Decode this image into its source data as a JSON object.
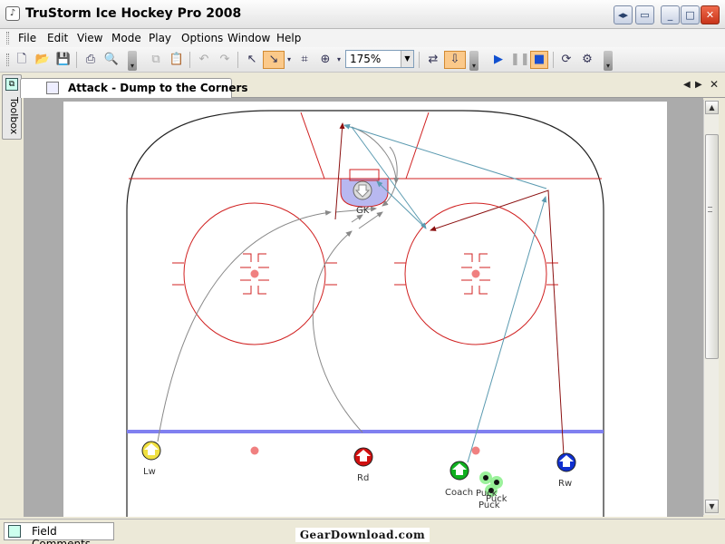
{
  "window": {
    "title": "TruStorm Ice Hockey Pro 2008",
    "icon": "app-icon",
    "controls": [
      "restore-icon",
      "dock-icon",
      "minimize-icon",
      "maximize-icon",
      "close-icon"
    ]
  },
  "menu": {
    "items": [
      {
        "label": "File"
      },
      {
        "label": "Edit"
      },
      {
        "label": "View"
      },
      {
        "label": "Mode"
      },
      {
        "label": "Play"
      },
      {
        "label": "Options"
      },
      {
        "label": "Window"
      },
      {
        "label": "Help"
      }
    ]
  },
  "toolbar": {
    "zoom": "175%",
    "buttons": [
      "new-file-icon",
      "open-folder-icon",
      "save-icon",
      "print-icon",
      "print-preview-icon",
      "copy-icon",
      "paste-icon",
      "undo-icon",
      "redo-icon",
      "select-arrow-icon",
      "draw-line-icon",
      "crop-icon",
      "zoom-icon",
      "animate-icon",
      "export-icon",
      "play-icon",
      "pause-icon",
      "stop-icon",
      "loop-icon",
      "settings-icon"
    ]
  },
  "sidebar": {
    "toolbox_label": "Toolbox"
  },
  "document": {
    "tab_title": "Attack - Dump to the Corners"
  },
  "rink": {
    "accent_red": "#d02020",
    "blue_line": "#8080f0",
    "players": [
      {
        "label": "Lw",
        "color": "#f0e040"
      },
      {
        "label": "Rd",
        "color": "#d01010"
      },
      {
        "label": "Coach",
        "color": "#10b020"
      },
      {
        "label": "Rw",
        "color": "#1030d0"
      },
      {
        "label": "GK",
        "color": "#c0c0c0"
      }
    ],
    "pucks": [
      "Puck",
      "Puck",
      "Puck"
    ]
  },
  "bottom": {
    "field_comments": "Field Comments",
    "watermark": "GearDownload.com"
  }
}
